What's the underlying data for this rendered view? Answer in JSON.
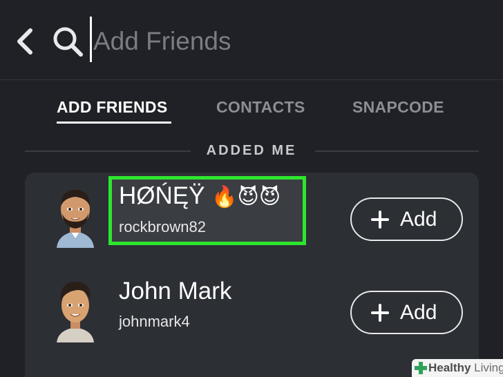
{
  "search": {
    "placeholder": "Add Friends"
  },
  "tabs": [
    {
      "label": "ADD FRIENDS",
      "active": true
    },
    {
      "label": "CONTACTS",
      "active": false
    },
    {
      "label": "SNAPCODE",
      "active": false
    }
  ],
  "section": {
    "title": "ADDED ME"
  },
  "friends": [
    {
      "display_name": "HØŃĘŸ",
      "emoji": "🔥😈😈",
      "username": "rockbrown82",
      "add_label": "Add",
      "highlighted": true
    },
    {
      "display_name": "John Mark",
      "username": "johnmark4",
      "add_label": "Add",
      "highlighted": false
    }
  ],
  "watermark": {
    "brand": "Healthy",
    "brand_light": "Living"
  },
  "colors": {
    "background": "#1f2126",
    "card": "#2c2f34",
    "highlight": "#2ee62e",
    "text_muted": "#8b8e95"
  },
  "icons": [
    "back-chevron-icon",
    "search-icon",
    "plus-icon",
    "bitmoji-avatar",
    "healthy-living-cross-icon"
  ]
}
